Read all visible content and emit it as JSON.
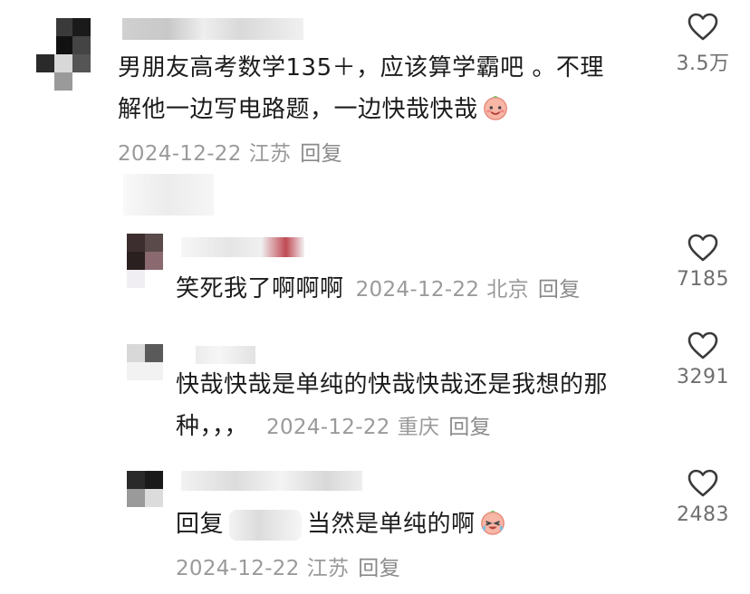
{
  "comments": [
    {
      "text_line1": "男朋友高考数学135＋，应该算学霸吧 。不理",
      "text_line2": "解他一边写电路题，一边快哉快哉",
      "date": "2024-12-22",
      "location": "江苏",
      "reply": "回复",
      "likes": "3.5万"
    },
    {
      "text": "笑死我了啊啊啊",
      "date": "2024-12-22",
      "location": "北京",
      "reply": "回复",
      "likes": "7185"
    },
    {
      "text_line1": "快哉快哉是单纯的快哉快哉还是我想的那",
      "text_line2": "种，，，",
      "date": "2024-12-22",
      "location": "重庆",
      "reply": "回复",
      "likes": "3291"
    },
    {
      "reply_prefix": "回复",
      "text": "当然是单纯的啊",
      "date": "2024-12-22",
      "location": "江苏",
      "reply": "回复",
      "likes": "2483"
    }
  ],
  "icons": {
    "like": "heart-outline-icon",
    "emoji_1": "smiling-face-emoji-icon",
    "emoji_2": "crying-laughing-emoji-icon"
  },
  "colors": {
    "text": "#1c1c1c",
    "meta": "#9a9a9a",
    "icon": "#3a3a3a"
  }
}
